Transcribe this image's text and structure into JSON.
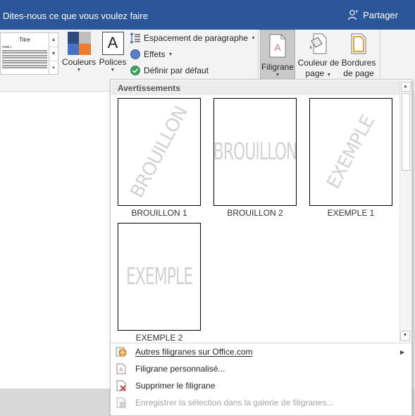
{
  "titlebar": {
    "tell_me": "Dites-nous ce que vous voulez faire",
    "share_label": "Partager",
    "background_color": "#2b579a"
  },
  "ribbon": {
    "style_gallery": {
      "title": "Titre",
      "heading": "TITRE 1"
    },
    "colors_label": "Couleurs",
    "fonts_label": "Polices",
    "fonts_icon_glyph": "A",
    "paragraph_spacing_label": "Espacement de paragraphe",
    "effects_label": "Effets",
    "set_default_label": "Définir par défaut",
    "watermark_label": "Filigrane",
    "page_color_line1": "Couleur de",
    "page_color_line2": "page",
    "page_borders_line1": "Bordures",
    "page_borders_line2": "de page"
  },
  "gallery": {
    "section_title": "Avertissements",
    "items": [
      {
        "caption": "BROUILLON 1",
        "watermark_text": "BROUILLON",
        "orientation": "diagonal"
      },
      {
        "caption": "BROUILLON 2",
        "watermark_text": "BROUILLON",
        "orientation": "horizontal"
      },
      {
        "caption": "EXEMPLE 1",
        "watermark_text": "EXEMPLE",
        "orientation": "diagonal"
      },
      {
        "caption": "EXEMPLE 2",
        "watermark_text": "EXEMPLE",
        "orientation": "horizontal"
      }
    ]
  },
  "menu": {
    "items": [
      {
        "label": "Autres filigranes sur Office.com",
        "icon": "globe-icon",
        "has_submenu": true,
        "enabled": true
      },
      {
        "label": "Filigrane personnalisé...",
        "icon": "custom-watermark-icon",
        "has_submenu": false,
        "enabled": true
      },
      {
        "label": "Supprimer le filigrane",
        "icon": "remove-watermark-icon",
        "has_submenu": false,
        "enabled": true
      },
      {
        "label": "Enregistrer la sélection dans la galerie de filigranes...",
        "icon": "save-to-gallery-icon",
        "has_submenu": false,
        "enabled": false
      }
    ]
  },
  "colors": {
    "accent": "#2b579a",
    "theme_swatches": [
      "#2e4a7d",
      "#bfbfbf",
      "#4472c4",
      "#ed7d31"
    ]
  }
}
